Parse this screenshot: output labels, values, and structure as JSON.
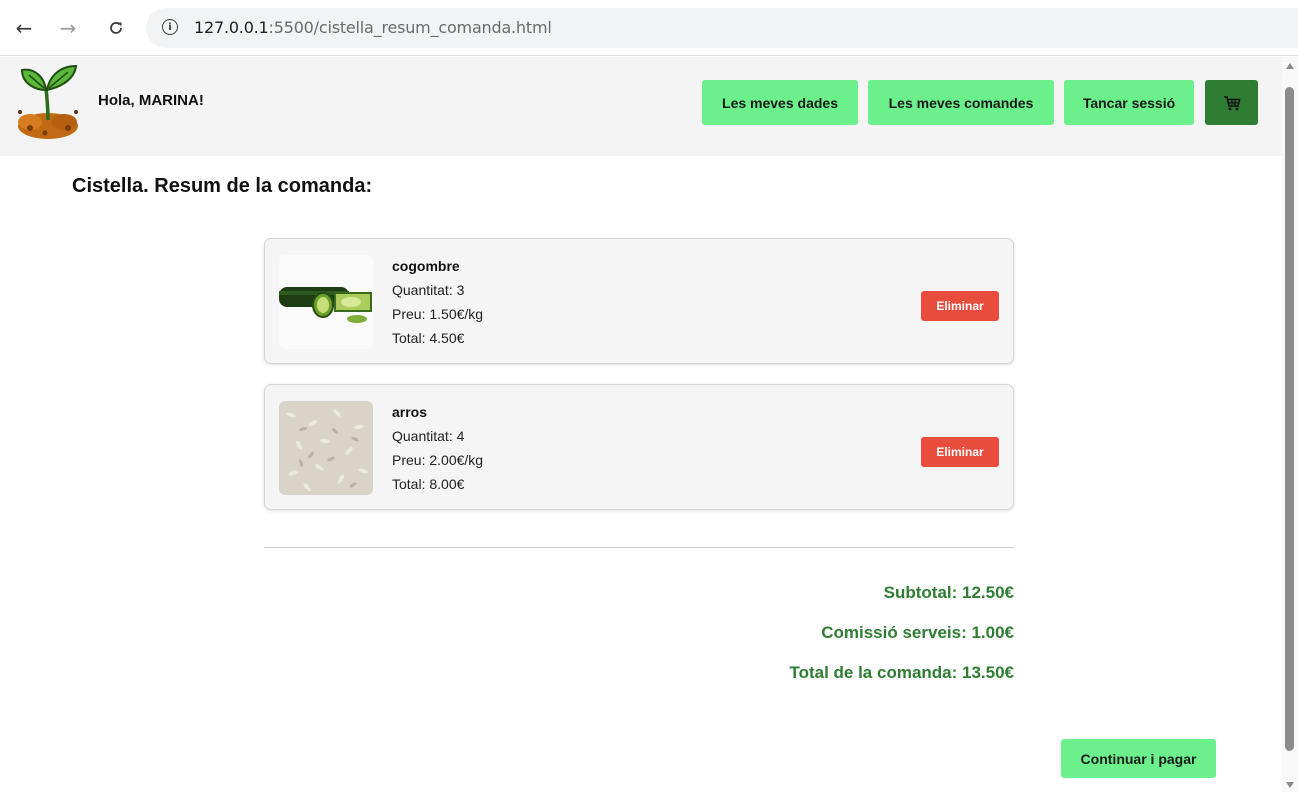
{
  "browser": {
    "back_icon": "arrow-left-icon",
    "forward_icon": "arrow-right-icon",
    "reload_icon": "reload-icon",
    "url_host": "127.0.0.1",
    "url_rest": ":5500/cistella_resum_comanda.html"
  },
  "header": {
    "logo_icon": "sprout-logo-icon",
    "greeting": "Hola, MARINA!",
    "nav": {
      "my_data": "Les meves dades",
      "my_orders": "Les meves comandes",
      "logout": "Tancar sessió"
    },
    "cart_icon": "cart-icon"
  },
  "page": {
    "title": "Cistella. Resum de la comanda:"
  },
  "items": [
    {
      "name": "cogombre",
      "quantity": "Quantitat: 3",
      "price": "Preu: 1.50€/kg",
      "total": "Total: 4.50€",
      "delete_label": "Eliminar"
    },
    {
      "name": "arros",
      "quantity": "Quantitat: 4",
      "price": "Preu: 2.00€/kg",
      "total": "Total: 8.00€",
      "delete_label": "Eliminar"
    }
  ],
  "summary": {
    "subtotal": "Subtotal: 12.50€",
    "fee": "Comissió serveis: 1.00€",
    "total": "Total de la comanda: 13.50€"
  },
  "actions": {
    "pay_label": "Continuar i pagar"
  },
  "colors": {
    "accent_green": "#6cf08c",
    "dark_green": "#2e7d32",
    "danger_red": "#e74c3c"
  }
}
